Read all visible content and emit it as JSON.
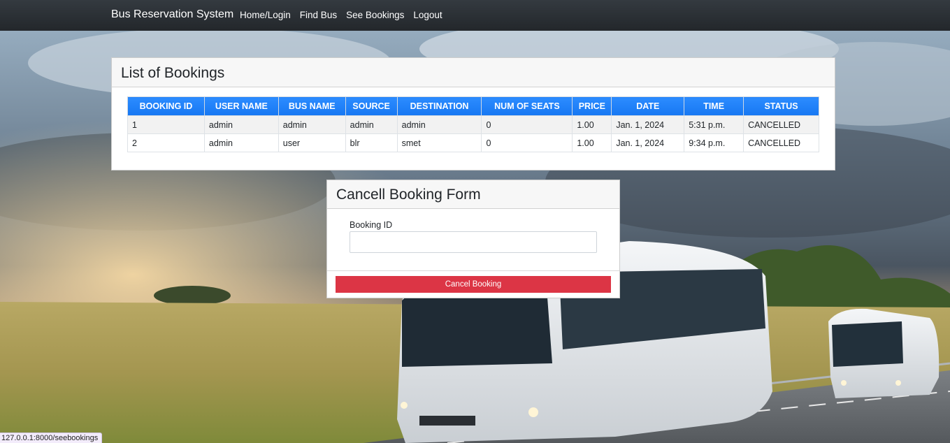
{
  "navbar": {
    "brand": "Bus Reservation System",
    "links": [
      "Home/Login",
      "Find Bus",
      "See Bookings",
      "Logout"
    ]
  },
  "bookings": {
    "title": "List of Bookings",
    "columns": [
      "BOOKING ID",
      "USER NAME",
      "BUS NAME",
      "SOURCE",
      "DESTINATION",
      "NUM OF SEATS",
      "PRICE",
      "DATE",
      "TIME",
      "STATUS"
    ],
    "rows": [
      [
        "1",
        "admin",
        "admin",
        "admin",
        "admin",
        "0",
        "1.00",
        "Jan. 1, 2024",
        "5:31 p.m.",
        "CANCELLED"
      ],
      [
        "2",
        "admin",
        "user",
        "blr",
        "smet",
        "0",
        "1.00",
        "Jan. 1, 2024",
        "9:34 p.m.",
        "CANCELLED"
      ]
    ]
  },
  "cancel_form": {
    "title": "Cancell Booking Form",
    "field_label": "Booking ID",
    "field_value": "",
    "button_label": "Cancel Booking"
  },
  "status_bar": {
    "url": "127.0.0.1:8000/seebookings"
  },
  "colors": {
    "navbar": "#343a40",
    "table_header": "#1e90ff",
    "danger": "#dc3545"
  }
}
